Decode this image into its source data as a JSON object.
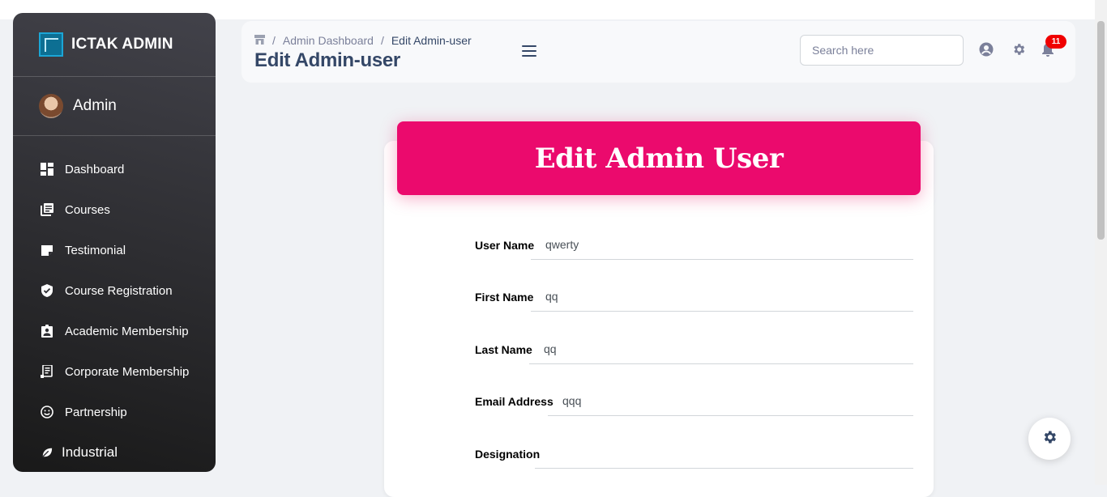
{
  "sidebar": {
    "brand": "ICTAK ADMIN",
    "user": "Admin",
    "items": [
      {
        "label": "Dashboard",
        "icon": "dashboard-icon"
      },
      {
        "label": "Courses",
        "icon": "library-books-icon"
      },
      {
        "label": "Testimonial",
        "icon": "sticky-note-icon"
      },
      {
        "label": "Course Registration",
        "icon": "verified-shield-icon"
      },
      {
        "label": "Academic Membership",
        "icon": "assignment-ind-icon"
      },
      {
        "label": "Corporate Membership",
        "icon": "receipt-icon"
      },
      {
        "label": "Partnership",
        "icon": "smiley-icon"
      },
      {
        "label": "Industrial",
        "icon": "leaf-icon"
      }
    ]
  },
  "header": {
    "breadcrumb": [
      "Admin Dashboard",
      "Edit Admin-user"
    ],
    "title": "Edit Admin-user",
    "search_placeholder": "Search here",
    "notification_count": "11"
  },
  "form": {
    "title": "Edit Admin User",
    "fields": [
      {
        "label": "User Name",
        "value": "qwerty"
      },
      {
        "label": "First Name",
        "value": "qq"
      },
      {
        "label": "Last Name",
        "value": "qq"
      },
      {
        "label": "Email Address",
        "value": "qqq"
      },
      {
        "label": "Designation",
        "value": ""
      }
    ]
  },
  "colors": {
    "accent": "#eb0a6d",
    "sidebar_dark": "#191919",
    "text": "#344767"
  }
}
